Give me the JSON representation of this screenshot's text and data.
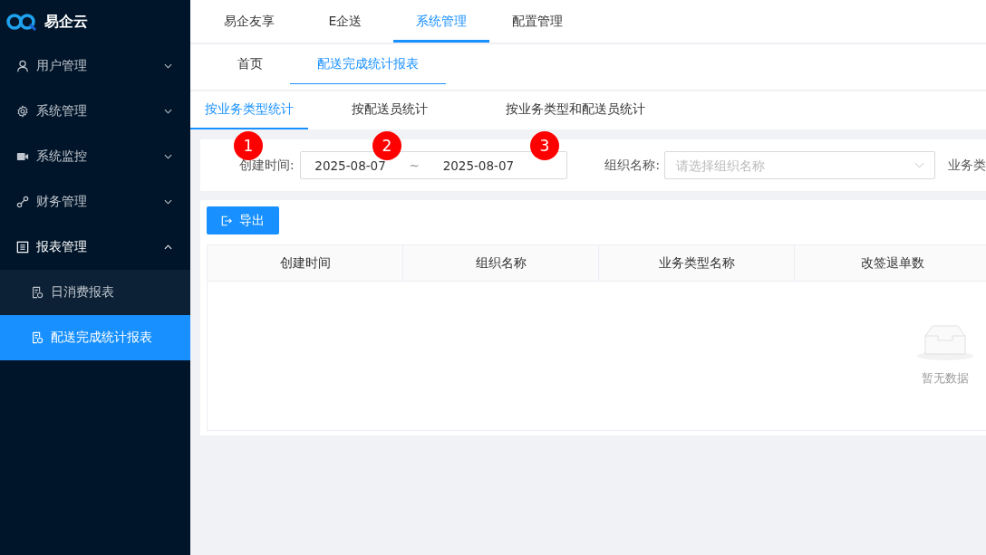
{
  "app": {
    "name": "易企云"
  },
  "sidebar": {
    "items": [
      {
        "label": "用户管理",
        "expanded": false
      },
      {
        "label": "系统管理",
        "expanded": false
      },
      {
        "label": "系统监控",
        "expanded": false
      },
      {
        "label": "财务管理",
        "expanded": false
      },
      {
        "label": "报表管理",
        "expanded": true,
        "children": [
          {
            "label": "日消费报表",
            "selected": false
          },
          {
            "label": "配送完成统计报表",
            "selected": true
          }
        ]
      }
    ]
  },
  "top_nav": [
    {
      "label": "易企友享",
      "selected": false
    },
    {
      "label": "E企送",
      "selected": false
    },
    {
      "label": "系统管理",
      "selected": true
    },
    {
      "label": "配置管理",
      "selected": false
    }
  ],
  "page_tabs": [
    {
      "label": "首页",
      "selected": false
    },
    {
      "label": "配送完成统计报表",
      "selected": true
    }
  ],
  "report_tabs": [
    {
      "label": "按业务类型统计",
      "selected": true
    },
    {
      "label": "按配送员统计",
      "selected": false
    },
    {
      "label": "按业务类型和配送员统计",
      "selected": false
    }
  ],
  "annotations": [
    "1",
    "2",
    "3"
  ],
  "filters": {
    "date_label": "创建时间:",
    "date_start": "2025-08-07",
    "date_sep": "~",
    "date_end": "2025-08-07",
    "org_label": "组织名称:",
    "org_placeholder": "请选择组织名称",
    "type_label": "业务类"
  },
  "export_button": "导出",
  "table": {
    "columns": [
      "创建时间",
      "组织名称",
      "业务类型名称",
      "改签退单数"
    ],
    "empty_text": "暂无数据"
  }
}
